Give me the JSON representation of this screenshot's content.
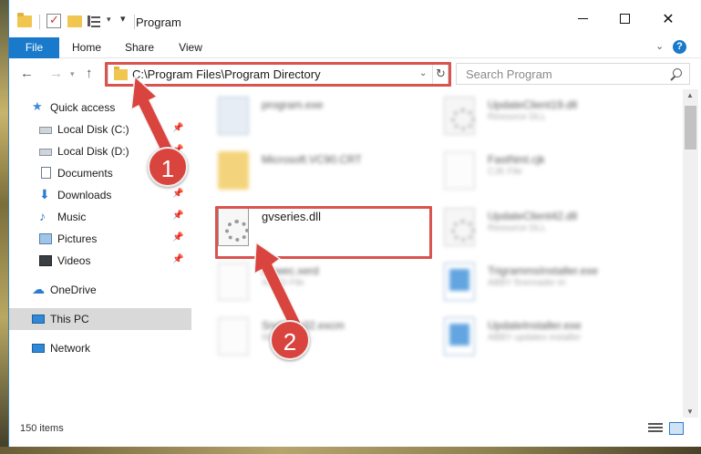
{
  "window": {
    "title": "Program"
  },
  "ribbon": {
    "tabs": [
      {
        "label": "File"
      },
      {
        "label": "Home"
      },
      {
        "label": "Share"
      },
      {
        "label": "View"
      }
    ]
  },
  "address": {
    "path": "C:\\Program Files\\Program Directory",
    "search_placeholder": "Search Program"
  },
  "nav_pane": {
    "items": [
      {
        "label": "Quick access",
        "icon": "star-icon",
        "pinned": false
      },
      {
        "label": "Local Disk (C:)",
        "icon": "drive-icon",
        "pinned": true
      },
      {
        "label": "Local Disk (D:)",
        "icon": "drive-icon",
        "pinned": true
      },
      {
        "label": "Documents",
        "icon": "documents-icon",
        "pinned": false
      },
      {
        "label": "Downloads",
        "icon": "downloads-icon",
        "pinned": true
      },
      {
        "label": "Music",
        "icon": "music-icon",
        "pinned": true
      },
      {
        "label": "Pictures",
        "icon": "pictures-icon",
        "pinned": true
      },
      {
        "label": "Videos",
        "icon": "videos-icon",
        "pinned": true
      },
      {
        "label": "OneDrive",
        "icon": "onedrive-icon",
        "pinned": false
      },
      {
        "label": "This PC",
        "icon": "this-pc-icon",
        "pinned": false,
        "selected": true
      },
      {
        "label": "Network",
        "icon": "network-icon",
        "pinned": false
      }
    ]
  },
  "files": [
    {
      "name": "program.exe",
      "sub": "",
      "icon": "exe-icon",
      "blurred": true
    },
    {
      "name": "UpdateClient19.dll",
      "sub": "Resource DLL",
      "icon": "dll-icon",
      "blurred": true
    },
    {
      "name": "Microsoft.VC90.CRT",
      "sub": "",
      "icon": "folder-icon",
      "blurred": true
    },
    {
      "name": "FastNml.cjk",
      "sub": "CJK File",
      "icon": "file-icon",
      "blurred": true
    },
    {
      "name": "gvseries.dll",
      "sub": "",
      "icon": "dll-icon",
      "blurred": false
    },
    {
      "name": "UpdateClient42.dll",
      "sub": "Resource DLL",
      "icon": "dll-icon",
      "blurred": true
    },
    {
      "name": "Ahwec.xerd",
      "sub": "XERD File",
      "icon": "file-icon",
      "blurred": true
    },
    {
      "name": "TrigrammsInstaller.exe",
      "sub": "ABBY finereader tri",
      "icon": "setup-icon",
      "blurred": true
    },
    {
      "name": "Snd1pro32.excm",
      "sub": "WCXM File",
      "icon": "file-icon",
      "blurred": true
    },
    {
      "name": "UpdateInstaller.exe",
      "sub": "ABBY updates installer",
      "icon": "setup-icon",
      "blurred": true
    }
  ],
  "status": {
    "item_count": "150 items"
  },
  "annotations": {
    "badge1": "1",
    "badge2": "2"
  },
  "colors": {
    "accent": "#1979ca",
    "callout": "#d9534f"
  }
}
